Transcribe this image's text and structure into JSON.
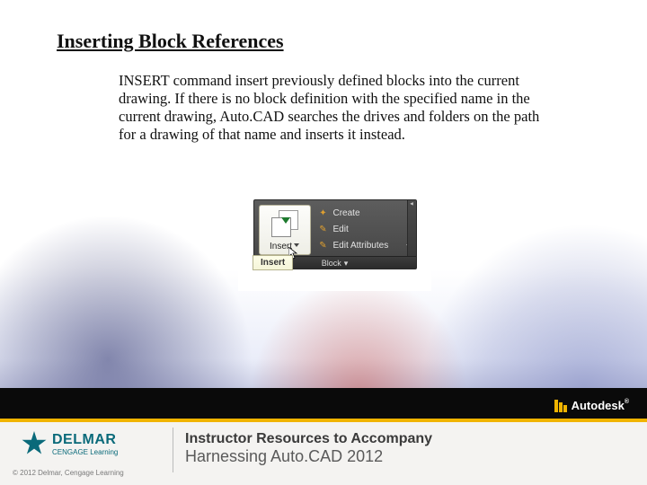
{
  "title": "Inserting Block References",
  "body": "INSERT command insert previously defined blocks into the current drawing. If there is no block definition with the specified name in the current drawing, Auto.CAD searches the drives and folders on the path for a drawing of that name and inserts it instead.",
  "ribbon": {
    "button_label": "Insert",
    "tooltip": "Insert",
    "panel_title": "Block",
    "items": {
      "create": "Create",
      "edit": "Edit",
      "edit_attributes": "Edit Attributes"
    }
  },
  "footer": {
    "delmar": {
      "line1": "DELMAR",
      "line2": "CENGAGE Learning",
      "line3": ""
    },
    "title_line1": "Instructor Resources to Accompany",
    "title_line2": "Harnessing Auto.CAD 2012",
    "autodesk": "Autodesk",
    "autodesk_reg": "®",
    "copyright": "© 2012 Delmar, Cengage Learning"
  }
}
